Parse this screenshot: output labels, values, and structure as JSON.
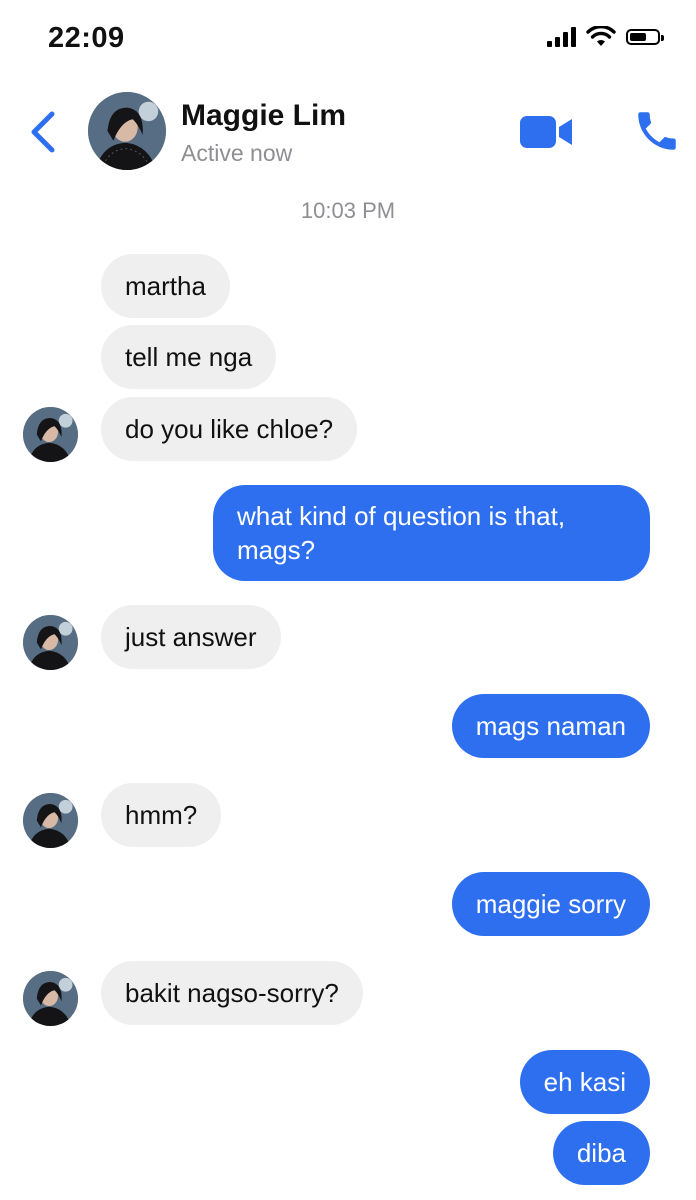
{
  "status_bar": {
    "time": "22:09",
    "battery_level": 0.6
  },
  "header": {
    "back_icon": "chevron-left-icon",
    "contact_name": "Maggie Lim",
    "contact_status": "Active now",
    "video_icon": "video-camera-icon",
    "phone_icon": "phone-icon",
    "accent_color": "#2e6ff0"
  },
  "conversation": {
    "timestamp": "10:03 PM",
    "messages": [
      {
        "direction": "incoming",
        "text": "martha"
      },
      {
        "direction": "incoming",
        "text": "tell me nga"
      },
      {
        "direction": "incoming",
        "text": "do you like chloe?"
      },
      {
        "direction": "outgoing",
        "text": "what kind of question is that, mags?"
      },
      {
        "direction": "incoming",
        "text": "just answer"
      },
      {
        "direction": "outgoing",
        "text": "mags naman"
      },
      {
        "direction": "incoming",
        "text": "hmm?"
      },
      {
        "direction": "outgoing",
        "text": "maggie sorry"
      },
      {
        "direction": "incoming",
        "text": "bakit nagso-sorry?"
      },
      {
        "direction": "outgoing",
        "text": "eh kasi"
      },
      {
        "direction": "outgoing",
        "text": "diba"
      }
    ],
    "incoming_bubble_color": "#efeff0",
    "outgoing_bubble_color": "#2e6ff0"
  }
}
